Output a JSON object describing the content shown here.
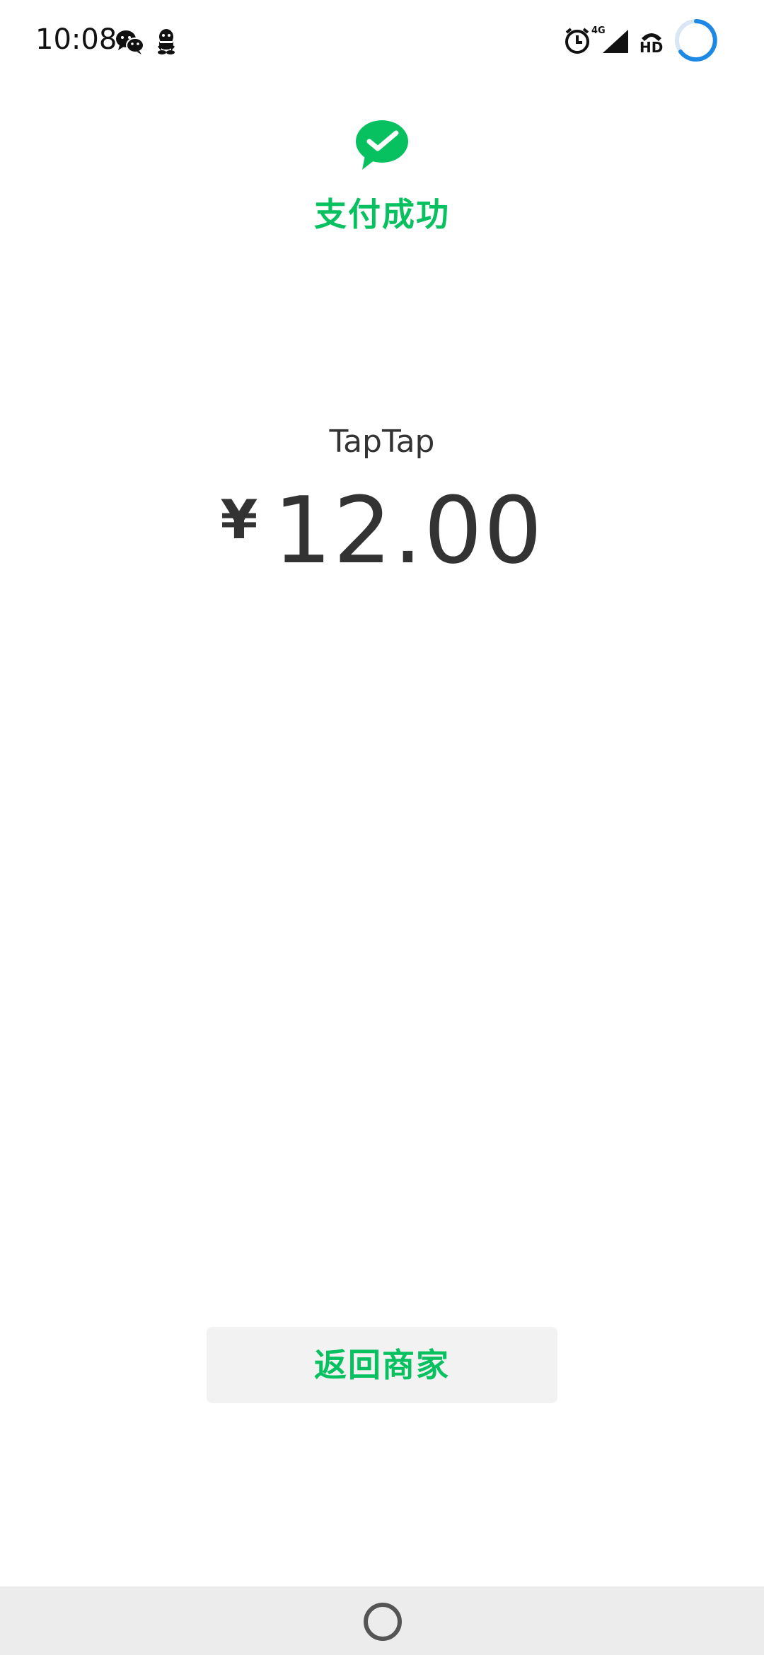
{
  "status_bar": {
    "time": "10:08",
    "left_icons": [
      "wechat-icon",
      "qq-icon"
    ],
    "right_icons": [
      "alarm-icon",
      "cellular-4g-signal-icon",
      "hd-voice-icon",
      "loading-ring-icon"
    ],
    "network_type": "4G",
    "hd_label": "HD"
  },
  "header": {
    "logo_icon": "wechat-pay-check-icon",
    "title": "支付成功",
    "accent_color": "#07c160"
  },
  "payment": {
    "merchant": "TapTap",
    "currency_symbol": "¥",
    "amount": "12.00"
  },
  "actions": {
    "return_label": "返回商家"
  },
  "nav_bar": {
    "home_icon": "home-circle-icon"
  }
}
